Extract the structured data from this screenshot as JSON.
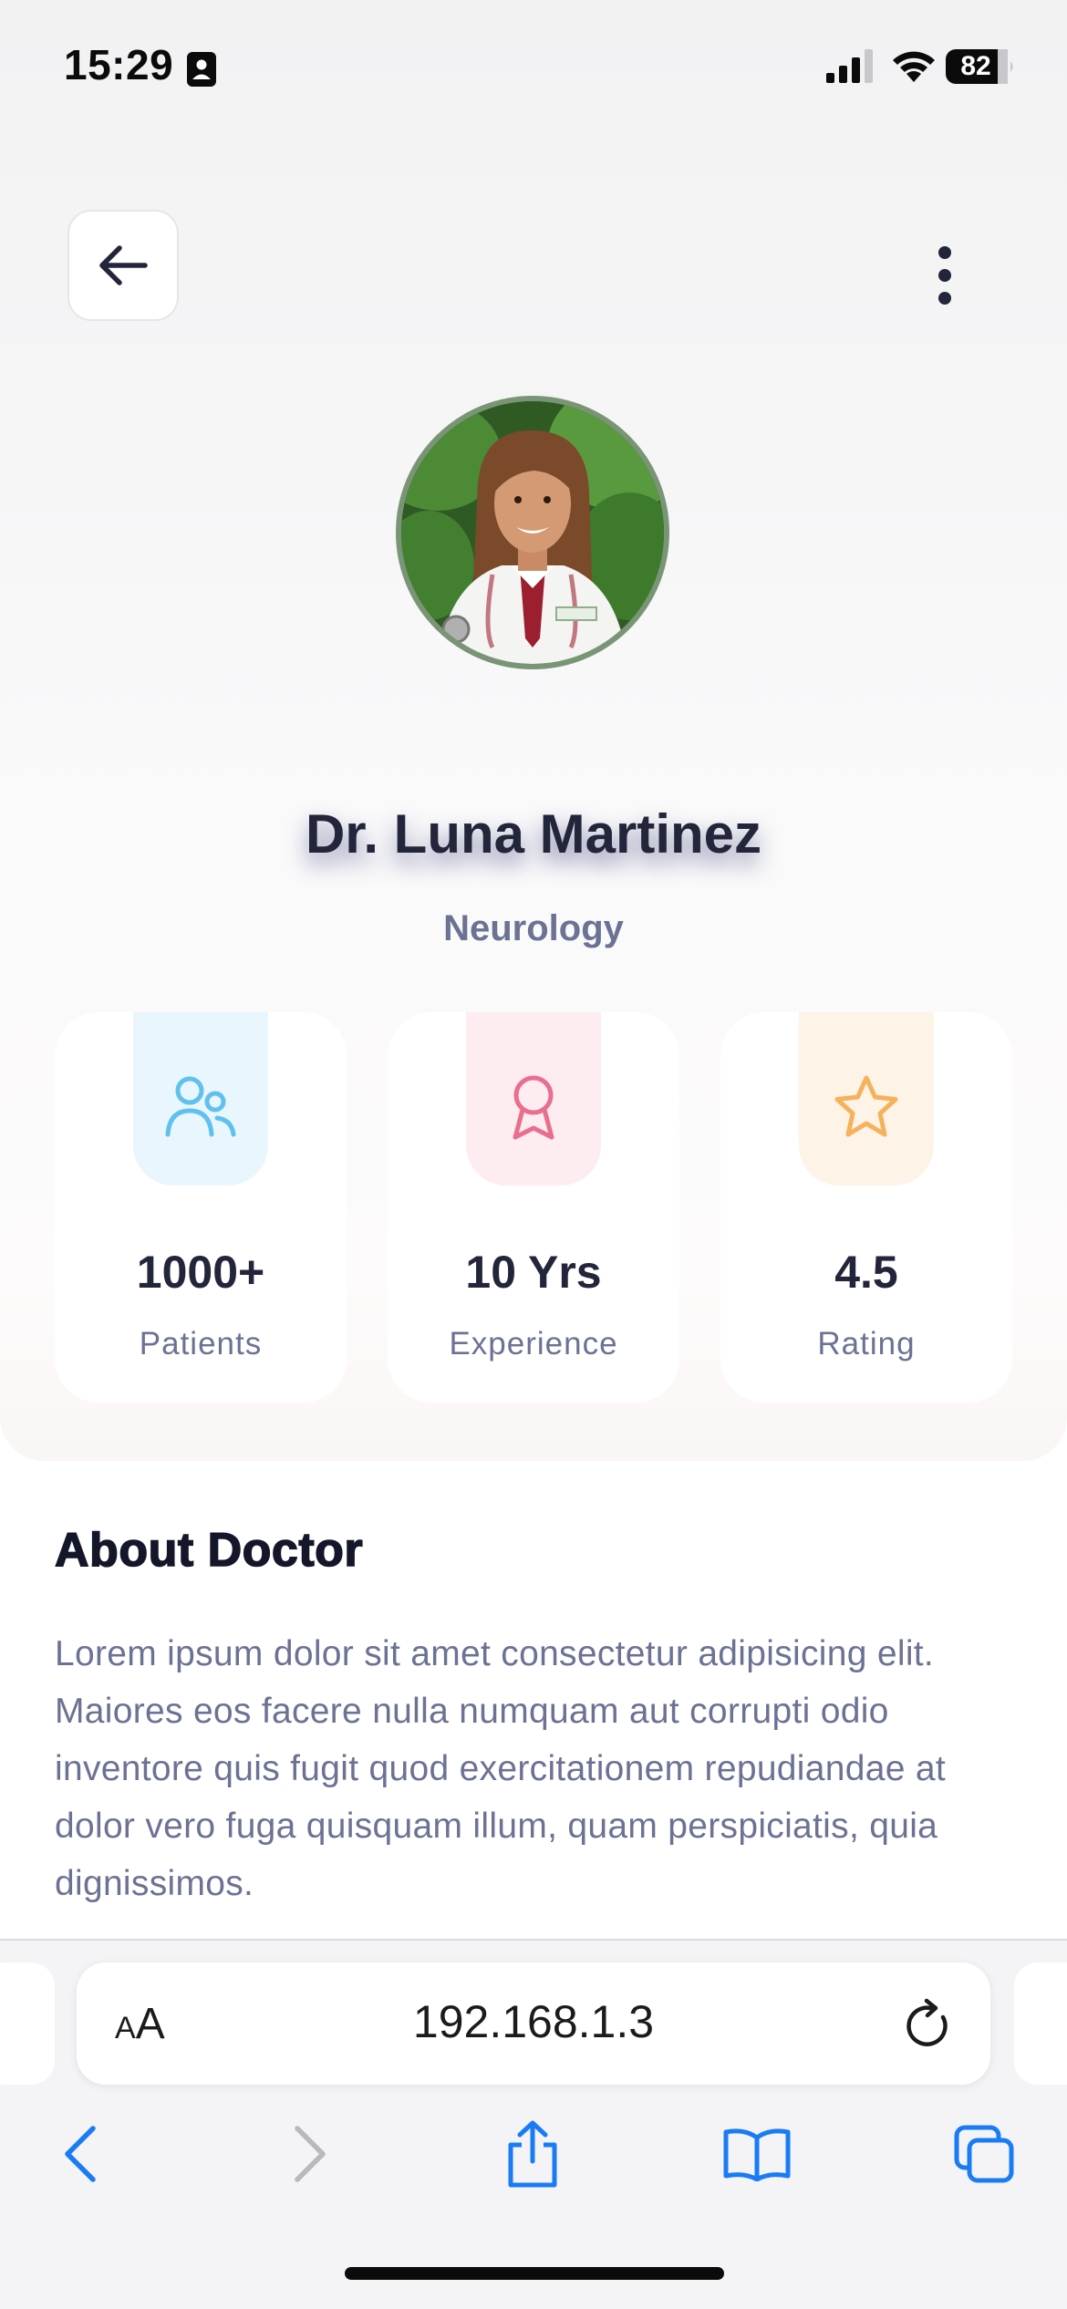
{
  "status_bar": {
    "time": "15:29",
    "battery": "82"
  },
  "doctor": {
    "name": "Dr. Luna Martinez",
    "specialty": "Neurology"
  },
  "stats": [
    {
      "value": "1000+",
      "label": "Patients",
      "icon": "users-icon",
      "color": "#5fc1ee",
      "bg": "#e9f6fd"
    },
    {
      "value": "10 Yrs",
      "label": "Experience",
      "icon": "award-ribbon-icon",
      "color": "#ea6e8e",
      "bg": "#fdecf0"
    },
    {
      "value": "4.5",
      "label": "Rating",
      "icon": "star-icon",
      "color": "#f5b25a",
      "bg": "#fef3e7"
    }
  ],
  "about": {
    "title": "About Doctor",
    "text": "Lorem ipsum dolor sit amet consectetur adipisicing elit. Maiores eos facere nulla numquam aut corrupti odio inventore quis fugit quod exercitationem repudiandae at dolor vero fuga quisquam illum, quam perspiciatis, quia dignissimos."
  },
  "browser": {
    "text_size_label_small": "A",
    "text_size_label_large": "A",
    "url": "192.168.1.3"
  },
  "colors": {
    "accent_blue": "#1a7cf5",
    "text_dark": "#23263a",
    "text_muted": "#6b7294"
  }
}
